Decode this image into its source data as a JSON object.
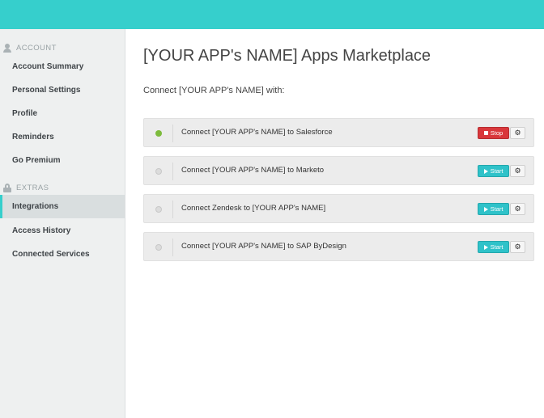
{
  "sidebar": {
    "account_header": "ACCOUNT",
    "account_items": [
      {
        "label": "Account Summary"
      },
      {
        "label": "Personal Settings"
      },
      {
        "label": "Profile"
      },
      {
        "label": "Reminders"
      },
      {
        "label": "Go Premium"
      }
    ],
    "extras_header": "EXTRAS",
    "extras_items": [
      {
        "label": "Integrations",
        "active": true
      },
      {
        "label": "Access History"
      },
      {
        "label": "Connected Services"
      }
    ]
  },
  "main": {
    "title": "[YOUR APP's NAME] Apps Marketplace",
    "subtitle": "Connect [YOUR APP's NAME] with:",
    "integrations": [
      {
        "label": "Connect [YOUR APP's NAME] to Salesforce",
        "status": "active",
        "button": "Stop"
      },
      {
        "label": "Connect [YOUR APP's NAME] to Marketo",
        "status": "inactive",
        "button": "Start"
      },
      {
        "label": "Connect Zendesk to [YOUR APP's NAME]",
        "status": "inactive",
        "button": "Start"
      },
      {
        "label": "Connect [YOUR APP's NAME] to SAP ByDesign",
        "status": "inactive",
        "button": "Start"
      }
    ]
  },
  "colors": {
    "accent": "#36cfcc",
    "stop": "#d9373b",
    "start": "#2fc2c9",
    "status_on": "#7dbb3c"
  },
  "icons": {
    "account": "user-icon",
    "extras": "lock-icon",
    "stop": "stop-icon",
    "start": "play-icon",
    "settings": "gear-icon",
    "settings_glyph": "⚙"
  }
}
